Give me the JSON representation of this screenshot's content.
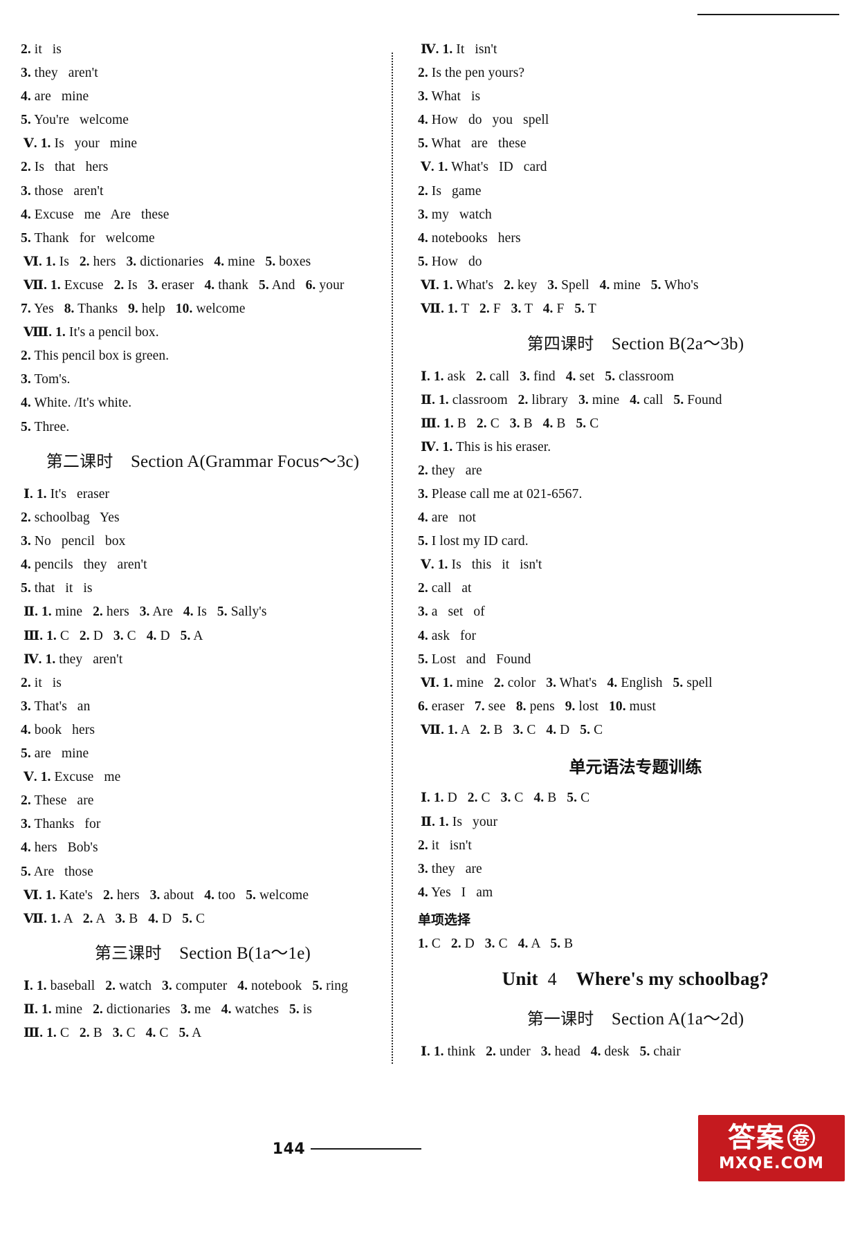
{
  "page": {
    "folio": "144",
    "watermark_cn": "答案",
    "watermark_circle_cn": "卷",
    "watermark_url": "MXQE.COM"
  },
  "left_column": {
    "blocks": [
      {
        "type": "answers",
        "lines": [
          "2. it   is",
          "3. they   aren't",
          "4. are   mine",
          "5. You're   welcome",
          "Ⅴ. 1. Is   your   mine",
          "2. Is   that   hers",
          "3. those   aren't",
          "4. Excuse   me   Are   these",
          "5. Thank   for   welcome",
          "Ⅵ. 1. Is   2. hers   3. dictionaries   4. mine   5. boxes",
          "Ⅶ. 1. Excuse   2. Is   3. eraser   4. thank   5. And   6. your",
          "7. Yes   8. Thanks   9. help   10. welcome",
          "Ⅷ. 1. It's a pencil box.",
          "2. This pencil box is green.",
          "3. Tom's.",
          "4. White. /It's white.",
          "5. Three."
        ]
      },
      {
        "type": "section-heading",
        "cn": "第二课时",
        "en": "Section A(Grammar Focus～3c)"
      },
      {
        "type": "answers",
        "lines": [
          "Ⅰ. 1. It's   eraser",
          "2. schoolbag   Yes",
          "3. No   pencil   box",
          "4. pencils   they   aren't",
          "5. that   it   is",
          "Ⅱ. 1. mine   2. hers   3. Are   4. Is   5. Sally's",
          "Ⅲ. 1. C   2. D   3. C   4. D   5. A",
          "Ⅳ. 1. they   aren't",
          "2. it   is",
          "3. That's   an",
          "4. book   hers",
          "5. are   mine",
          "Ⅴ. 1. Excuse   me",
          "2. These   are",
          "3. Thanks   for",
          "4. hers   Bob's",
          "5. Are   those",
          "Ⅵ. 1. Kate's   2. hers   3. about   4. too   5. welcome",
          "Ⅶ. 1. A   2. A   3. B   4. D   5. C"
        ]
      },
      {
        "type": "section-heading",
        "cn": "第三课时",
        "en": "Section B(1a～1e)"
      },
      {
        "type": "answers",
        "lines": [
          "Ⅰ. 1. baseball   2. watch   3. computer   4. notebook   5. ring",
          "Ⅱ. 1. mine   2. dictionaries   3. me   4. watches   5. is",
          "Ⅲ. 1. C   2. B   3. C   4. C   5. A"
        ]
      }
    ]
  },
  "right_column": {
    "blocks": [
      {
        "type": "answers",
        "lines": [
          "Ⅳ. 1. It   isn't",
          "2. Is the pen yours?",
          "3. What   is",
          "4. How   do   you   spell",
          "5. What   are   these",
          "Ⅴ. 1. What's   ID   card",
          "2. Is   game",
          "3. my   watch",
          "4. notebooks   hers",
          "5. How   do",
          "Ⅵ. 1. What's   2. key   3. Spell   4. mine   5. Who's",
          "Ⅶ. 1. T   2. F   3. T   4. F   5. T"
        ]
      },
      {
        "type": "section-heading",
        "cn": "第四课时",
        "en": "Section B(2a～3b)"
      },
      {
        "type": "answers",
        "lines": [
          "Ⅰ. 1. ask   2. call   3. find   4. set   5. classroom",
          "Ⅱ. 1. classroom   2. library   3. mine   4. call   5. Found",
          "Ⅲ. 1. B   2. C   3. B   4. B   5. C",
          "Ⅳ. 1. This is his eraser.",
          "2. they   are",
          "3. Please call me at 021-6567.",
          "4. are   not",
          "5. I lost my ID card.",
          "Ⅴ. 1. Is   this   it   isn't",
          "2. call   at",
          "3. a   set   of",
          "4. ask   for",
          "5. Lost   and   Found",
          "Ⅵ. 1. mine   2. color   3. What's   4. English   5. spell",
          "6. eraser   7. see   8. pens   9. lost   10. must",
          "Ⅶ. 1. A   2. B   3. C   4. D   5. C"
        ]
      },
      {
        "type": "block-heading",
        "cn": "单元语法专题训练"
      },
      {
        "type": "answers",
        "lines": [
          "Ⅰ. 1. D   2. C   3. C   4. B   5. C",
          "Ⅱ. 1. Is   your",
          "2. it   isn't",
          "3. they   are",
          "4. Yes   I   am"
        ]
      },
      {
        "type": "sub-heading",
        "cn": "单项选择"
      },
      {
        "type": "answers",
        "lines": [
          "1. C   2. D   3. C   4. A   5. B"
        ]
      },
      {
        "type": "unit-heading",
        "unit_label": "Unit",
        "unit_number": "4",
        "title": "Where's my schoolbag?"
      },
      {
        "type": "section-heading",
        "cn": "第一课时",
        "en": "Section A(1a～2d)"
      },
      {
        "type": "answers",
        "lines": [
          "Ⅰ. 1. think   2. under   3. head   4. desk   5. chair"
        ]
      }
    ]
  }
}
